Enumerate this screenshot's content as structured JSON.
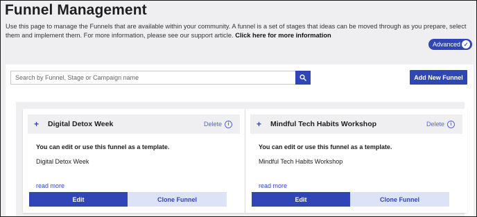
{
  "header": {
    "title": "Funnel Management",
    "description": "Use this page to manage the Funnels that are available within your community. A funnel is a set of stages that ideas can be moved through as you prepare, select them and implement them. For more information, please see our support article.",
    "more_link": "Click here for more information",
    "advanced_label": "Advanced"
  },
  "toolbar": {
    "search_placeholder": "Search by Funnel, Stage or Campaign name",
    "add_label": "Add New Funnel"
  },
  "funnels": [
    {
      "name": "Digital Detox Week",
      "delete_label": "Delete",
      "note": "You can edit or use this funnel as a template.",
      "description": "Digital Detox Week",
      "read_more": "read more",
      "edit_label": "Edit",
      "clone_label": "Clone Funnel"
    },
    {
      "name": "Mindful Tech Habits Workshop",
      "delete_label": "Delete",
      "note": "You can edit or use this funnel as a template.",
      "description": "Mindful Tech Habits Workshop",
      "read_more": "read more",
      "edit_label": "Edit",
      "clone_label": "Clone Funnel"
    }
  ],
  "colors": {
    "accent": "#3046b7",
    "accent_light": "#dde3f7",
    "background": "#efeff1"
  },
  "icons": {
    "search": "search-icon",
    "plus": "plus-icon",
    "info": "info-icon",
    "check": "check-icon"
  }
}
